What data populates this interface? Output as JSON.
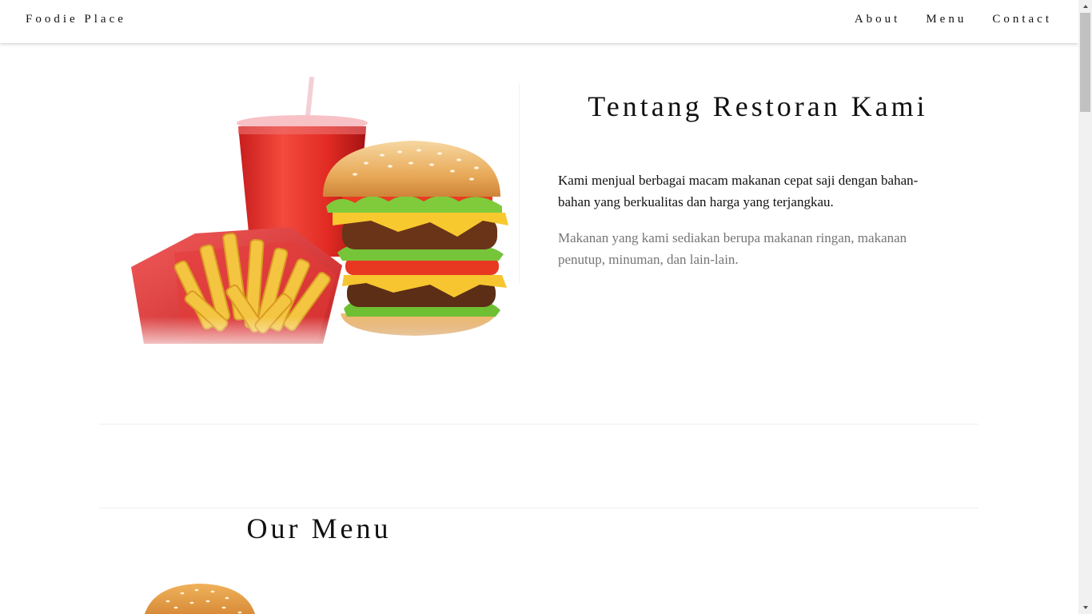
{
  "navbar": {
    "brand": "Foodie Place",
    "links": [
      "About",
      "Menu",
      "Contact"
    ]
  },
  "about": {
    "title": "Tentang Restoran Kami",
    "lead": "Kami menjual berbagai macam makanan cepat saji dengan bahan-bahan yang berkualitas dan harga yang terjangkau.",
    "body": "Makanan yang kami sediakan berupa makanan ringan, makanan penutup, minuman, dan lain-lain.",
    "image": "fast-food-image"
  },
  "menu": {
    "title": "Our Menu",
    "image": "burger-image"
  },
  "colors": {
    "text": "#111111",
    "muted": "#757575",
    "rule": "#eeeeee",
    "scrollbar_track": "#f1f1f1",
    "scrollbar_thumb": "#c1c1c1"
  }
}
